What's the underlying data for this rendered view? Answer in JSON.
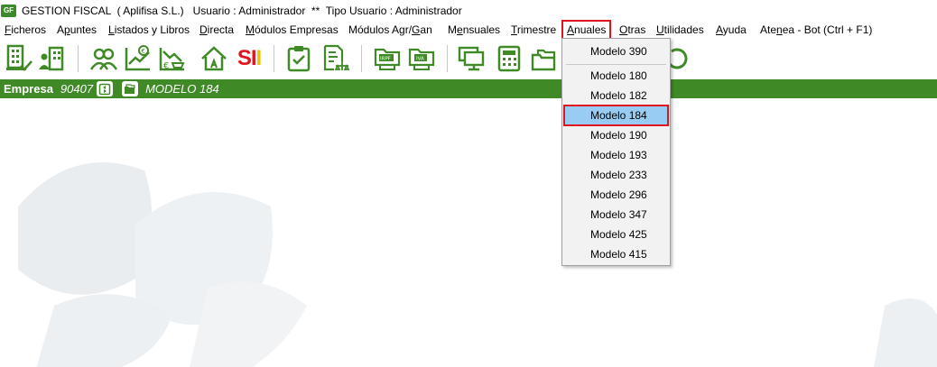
{
  "titlebar": {
    "logo_text": "GF",
    "title": "GESTION FISCAL  ( Aplifisa S.L.)   Usuario : Administrador  **  Tipo Usuario : Administrador"
  },
  "menubar": {
    "items": [
      {
        "pre": "",
        "mn": "F",
        "post": "icheros"
      },
      {
        "pre": "A",
        "mn": "p",
        "post": "untes"
      },
      {
        "pre": "",
        "mn": "L",
        "post": "istados y Libros"
      },
      {
        "pre": "",
        "mn": "D",
        "post": "irecta"
      },
      {
        "pre": "",
        "mn": "M",
        "post": "ódulos Empresas"
      },
      {
        "pre": "Módulos Agr/",
        "mn": "G",
        "post": "an"
      },
      {
        "pre": "M",
        "mn": "e",
        "post": "nsuales"
      },
      {
        "pre": "",
        "mn": "T",
        "post": "rimestre"
      },
      {
        "pre": "",
        "mn": "A",
        "post": "nuales"
      },
      {
        "pre": "",
        "mn": "O",
        "post": "tras"
      },
      {
        "pre": "",
        "mn": "U",
        "post": "tilidades"
      },
      {
        "pre": "",
        "mn": "A",
        "post": "yuda"
      },
      {
        "pre": "Ate",
        "mn": "n",
        "post": "ea - Bot (Ctrl + F1)"
      }
    ]
  },
  "toolbar": {
    "sii_label": "SII"
  },
  "companybar": {
    "label": "Empresa",
    "code": "90407",
    "model": "MODELO 184"
  },
  "dropdown": {
    "items": [
      "Modelo 390",
      "Modelo 180",
      "Modelo 182",
      "Modelo 184",
      "Modelo 190",
      "Modelo 193",
      "Modelo 233",
      "Modelo 296",
      "Modelo 347",
      "Modelo 425",
      "Modelo 415"
    ],
    "selected": "Modelo 184"
  },
  "colors": {
    "accent_green": "#3f8a26",
    "highlight_red": "#e0141e",
    "selection_blue": "#99ccf3",
    "sii_red": "#e0141e",
    "sii_yellow": "#f0c000"
  }
}
